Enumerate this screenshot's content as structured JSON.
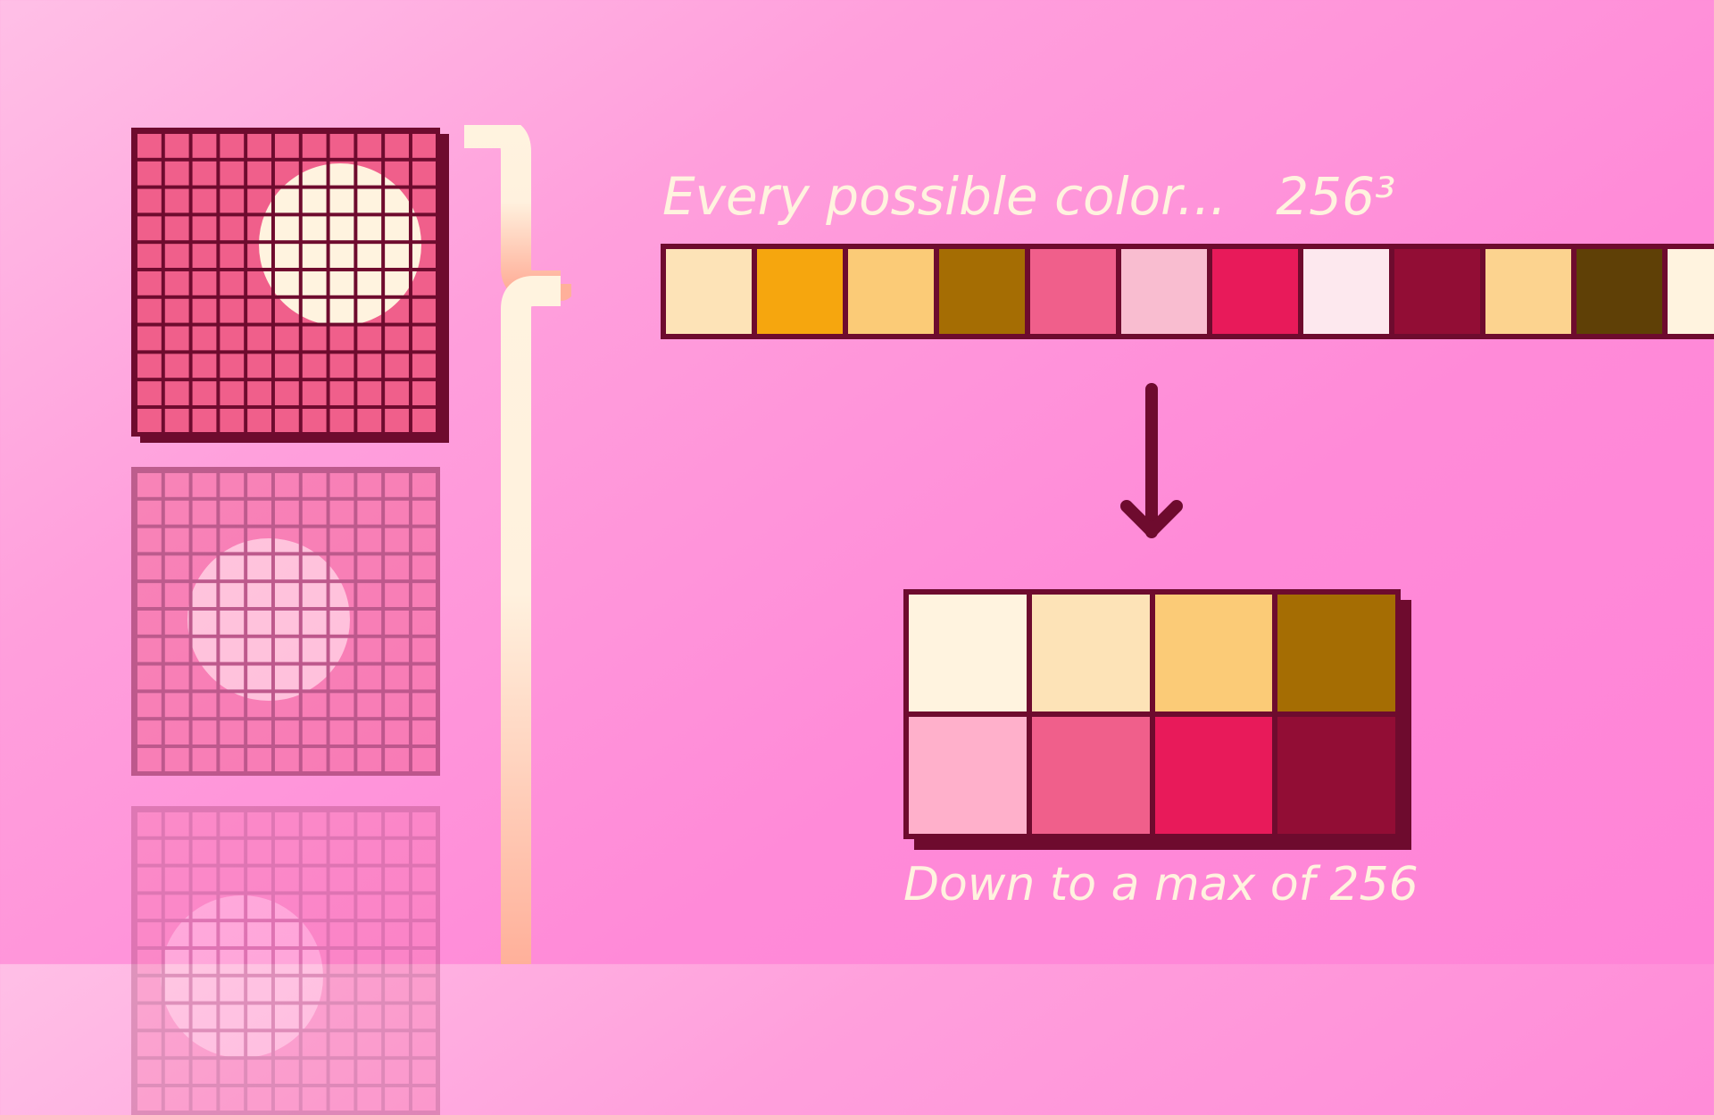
{
  "header": {
    "label": "Every possible color...   256³"
  },
  "strip": {
    "colors": [
      "#fde3b7",
      "#f6a60e",
      "#fbcb77",
      "#a56d03",
      "#f05f8b",
      "#f9bdd0",
      "#e81a5a",
      "#fde8ee",
      "#920d35",
      "#fcd38f",
      "#5f4006",
      "#fff3df"
    ]
  },
  "palette": {
    "colors": [
      "#fff3df",
      "#fde3b7",
      "#fbcb77",
      "#a56d03",
      "#ffb0cb",
      "#f05f8b",
      "#e81a5a",
      "#920d35"
    ]
  },
  "caption": {
    "label": "Down to a max of 256"
  },
  "image": {
    "fill_color": "#f05f8b",
    "circle_color": "#fff3df",
    "grid_color": "#6e0b2e"
  }
}
